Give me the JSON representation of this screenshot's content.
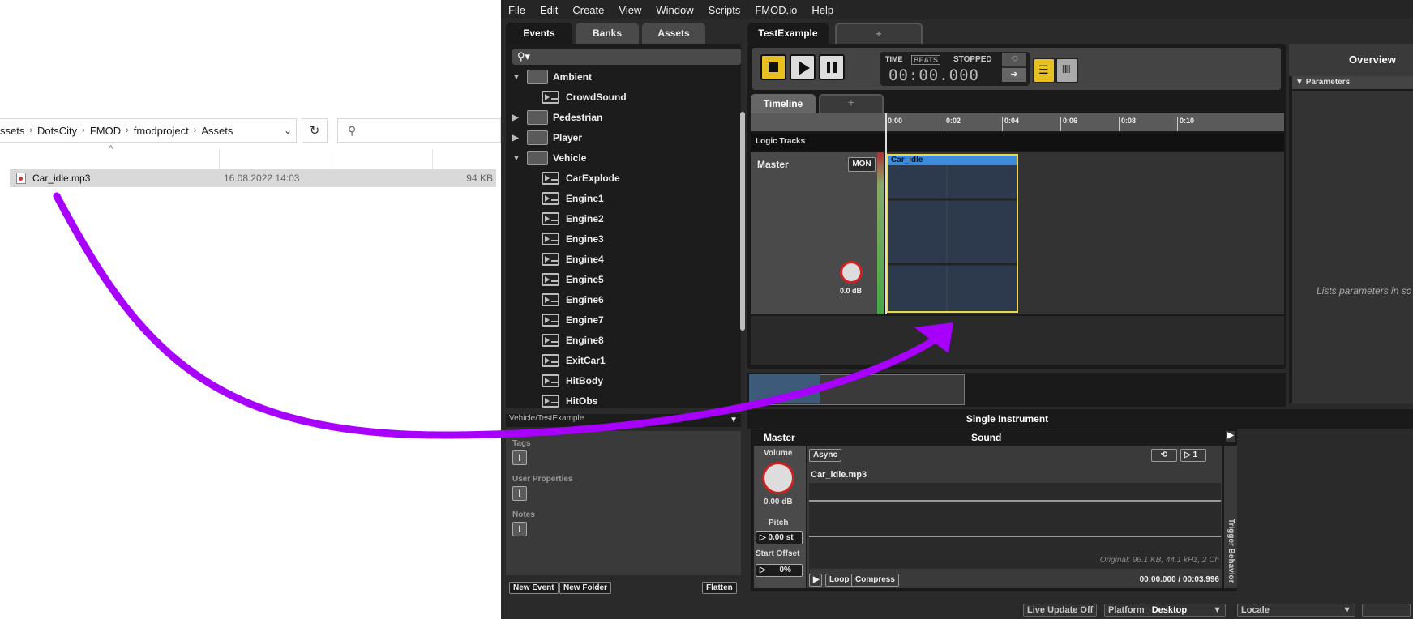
{
  "explorer": {
    "breadcrumbs": [
      "ssets",
      "DotsCity",
      "FMOD",
      "fmodproject",
      "Assets"
    ],
    "file": {
      "name": "Car_idle.mp3",
      "date": "16.08.2022 14:03",
      "size": "94 KB"
    }
  },
  "fmod": {
    "menu": [
      "File",
      "Edit",
      "Create",
      "View",
      "Window",
      "Scripts",
      "FMOD.io",
      "Help"
    ],
    "browser_tabs": [
      "Events",
      "Banks",
      "Assets"
    ],
    "editor_tab": "TestExample",
    "plus": "+",
    "tree": [
      {
        "type": "folder",
        "label": "Ambient",
        "expanded": true,
        "depth": 0
      },
      {
        "type": "event",
        "label": "CrowdSound",
        "depth": 1
      },
      {
        "type": "folder",
        "label": "Pedestrian",
        "expanded": false,
        "depth": 0
      },
      {
        "type": "folder",
        "label": "Player",
        "expanded": false,
        "depth": 0
      },
      {
        "type": "folder",
        "label": "Vehicle",
        "expanded": true,
        "depth": 0
      },
      {
        "type": "event",
        "label": "CarExplode",
        "depth": 1
      },
      {
        "type": "event",
        "label": "Engine1",
        "depth": 1
      },
      {
        "type": "event",
        "label": "Engine2",
        "depth": 1
      },
      {
        "type": "event",
        "label": "Engine3",
        "depth": 1
      },
      {
        "type": "event",
        "label": "Engine4",
        "depth": 1
      },
      {
        "type": "event",
        "label": "Engine5",
        "depth": 1
      },
      {
        "type": "event",
        "label": "Engine6",
        "depth": 1
      },
      {
        "type": "event",
        "label": "Engine7",
        "depth": 1
      },
      {
        "type": "event",
        "label": "Engine8",
        "depth": 1
      },
      {
        "type": "event",
        "label": "ExitCar1",
        "depth": 1
      },
      {
        "type": "event",
        "label": "HitBody",
        "depth": 1
      },
      {
        "type": "event",
        "label": "HitObs",
        "depth": 1
      }
    ],
    "path": "Vehicle/TestExample",
    "props": {
      "tags": "Tags",
      "user_props": "User Properties",
      "notes": "Notes",
      "ibeam": "I"
    },
    "bottom_buttons": {
      "new_event": "New Event",
      "new_folder": "New Folder",
      "flatten": "Flatten"
    },
    "transport": {
      "time_label": "TIME",
      "beats_label": "BEATS",
      "status": "STOPPED",
      "time": "00:00.000"
    },
    "timeline_tab": "Timeline",
    "ruler": [
      "0:00",
      "0:02",
      "0:04",
      "0:06",
      "0:08",
      "0:10"
    ],
    "logic_tracks": "Logic Tracks",
    "track": {
      "name": "Master",
      "mon": "MON",
      "volume": "0.0 dB"
    },
    "clip_name": "Car_idle",
    "overview": {
      "title": "Overview",
      "parameters": "Parameters",
      "hint": "Lists parameters in sc"
    },
    "instrument": {
      "title": "Single Instrument",
      "master": "Master",
      "sound": "Sound",
      "volume_label": "Volume",
      "volume": "0.00 dB",
      "pitch_label": "Pitch",
      "pitch": "0.00 st",
      "start_offset_label": "Start Offset",
      "start_offset": "0%",
      "async": "Async",
      "count": "1",
      "file": "Car_idle.mp3",
      "original": "Original: 96.1 KB, 44.1 kHz, 2 Ch",
      "loop": "Loop",
      "compress": "Compress",
      "position": "00:00.000 / 00:03.996",
      "trigger": "Trigger Behavior"
    },
    "status": {
      "live_update": "Live Update Off",
      "platform_label": "Platform",
      "platform": "Desktop",
      "locale_label": "Locale"
    }
  },
  "colors": {
    "arrow": "#a800ff",
    "clip_border": "#e8d84a",
    "clip_header": "#3d8dde",
    "active_toggle": "#e8c020"
  }
}
